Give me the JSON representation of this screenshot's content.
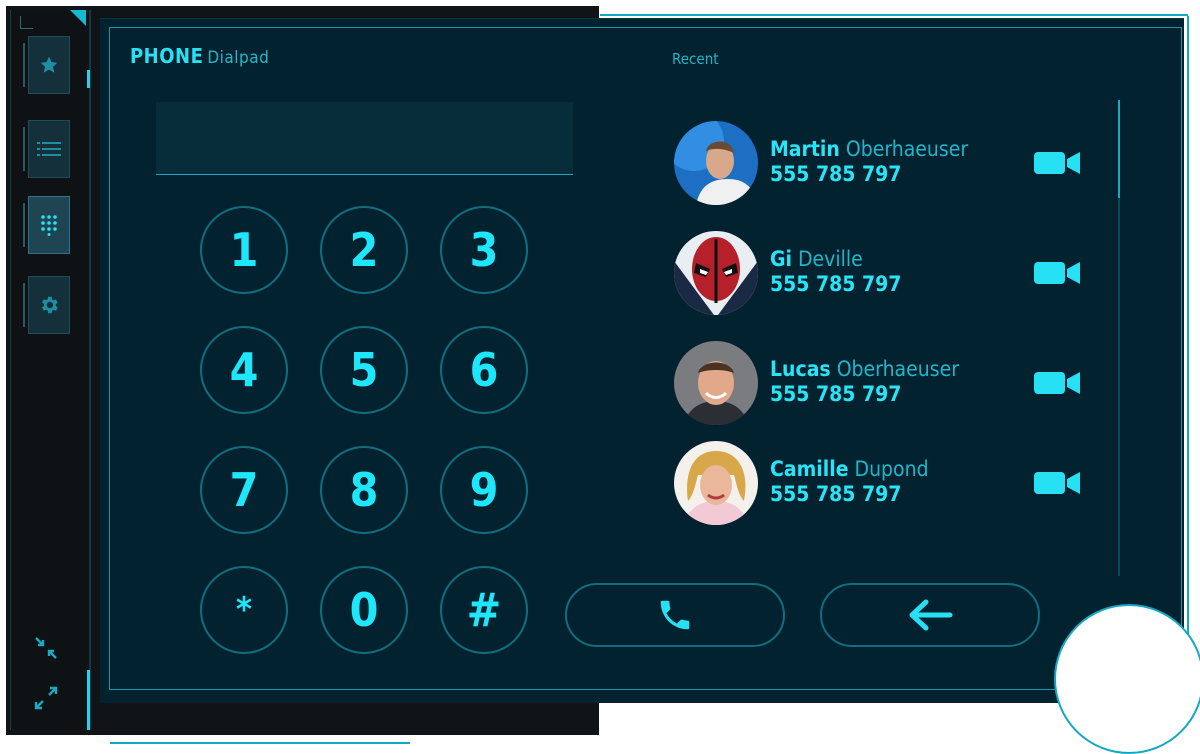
{
  "app": {
    "title": "PHONE",
    "subtitle": "Dialpad"
  },
  "recent": {
    "title": "Recent"
  },
  "sidebar": {
    "items": [
      {
        "name": "favorites",
        "icon": "star-icon"
      },
      {
        "name": "list",
        "icon": "list-icon"
      },
      {
        "name": "dialpad",
        "icon": "dialpad-icon",
        "active": true
      },
      {
        "name": "settings",
        "icon": "gear-icon"
      }
    ],
    "bottom_icons": [
      "collapse-icon",
      "expand-icon"
    ]
  },
  "dialer": {
    "display_value": "",
    "keys": [
      "1",
      "2",
      "3",
      "4",
      "5",
      "6",
      "7",
      "8",
      "9",
      "*",
      "0",
      "#"
    ],
    "call_icon": "phone-icon",
    "back_icon": "back-arrow-icon"
  },
  "contacts": [
    {
      "first": "Martin",
      "last": "Oberhaeuser",
      "phone": "555 785 797",
      "action_icon": "video-camera-icon"
    },
    {
      "first": "Gi",
      "last": "Deville",
      "phone": "555 785 797",
      "action_icon": "video-camera-icon"
    },
    {
      "first": "Lucas",
      "last": "Oberhaeuser",
      "phone": "555 785 797",
      "action_icon": "video-camera-icon"
    },
    {
      "first": "Camille",
      "last": "Dupond",
      "phone": "555 785 797",
      "action_icon": "video-camera-icon"
    }
  ],
  "colors": {
    "accent": "#28e4f6",
    "panel": "#03222f",
    "frame": "#1596ad",
    "key_border": "#0f6f7f"
  }
}
